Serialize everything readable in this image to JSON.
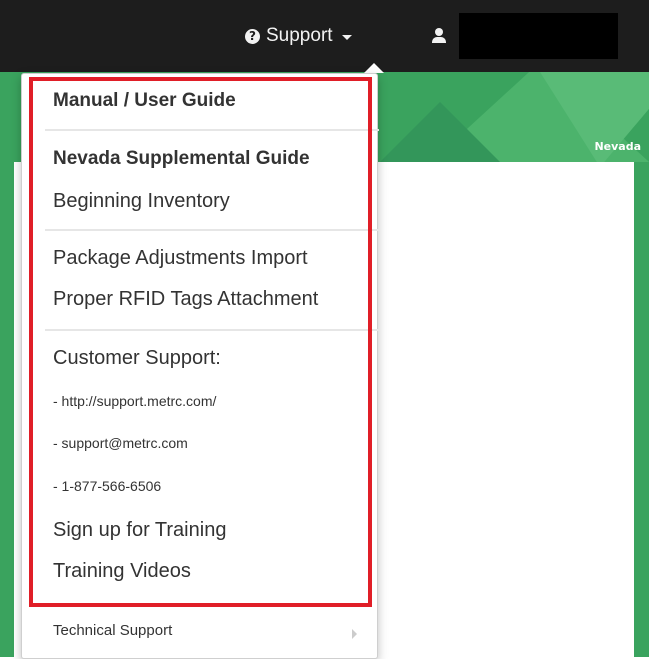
{
  "navbar": {
    "support_label": "Support",
    "support_icon": "question-circle-icon",
    "user_icon": "user-icon",
    "username_redacted": ""
  },
  "banner": {
    "state_label": "Nevada"
  },
  "support_menu": {
    "items": [
      {
        "label": "Manual / User Guide",
        "type": "header"
      },
      {
        "label": "Nevada Supplemental Guide",
        "type": "header"
      },
      {
        "label": "Beginning Inventory",
        "type": "link"
      },
      {
        "label": "Package Adjustments Import",
        "type": "link"
      },
      {
        "label": "Proper RFID Tags Attachment",
        "type": "link"
      },
      {
        "label": "Customer Support:",
        "type": "text"
      },
      {
        "label": "- http://support.metrc.com/",
        "type": "link"
      },
      {
        "label": "- support@metrc.com",
        "type": "link"
      },
      {
        "label": "- 1-877-566-6506",
        "type": "text"
      },
      {
        "label": "Sign up for Training",
        "type": "link"
      },
      {
        "label": "Training Videos",
        "type": "link"
      }
    ],
    "submenu_label": "Technical Support",
    "submenu_icon": "chevron-right-icon"
  },
  "colors": {
    "navbar_bg": "#1d1d1d",
    "banner_green": "#3aa35e",
    "highlight_red": "#e01e27",
    "menu_text": "#333333"
  }
}
